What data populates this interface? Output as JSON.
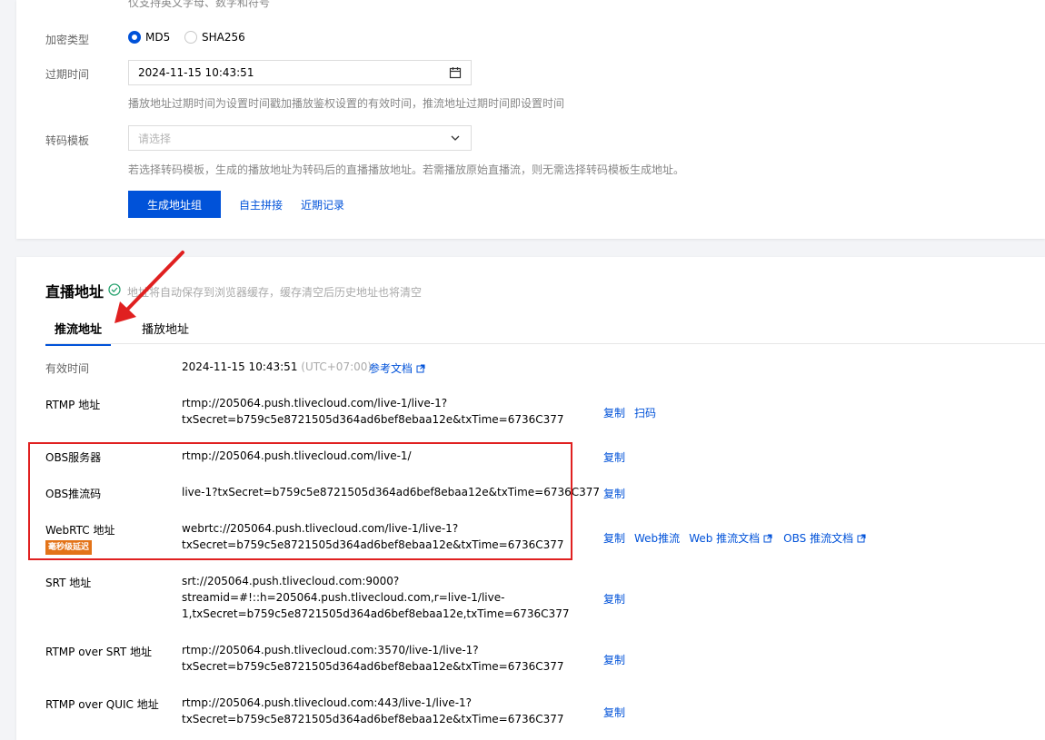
{
  "form": {
    "top_hint": "仅支持英文字母、数字和符号",
    "encrypt_label": "加密类型",
    "encrypt_options": [
      "MD5",
      "SHA256"
    ],
    "expire_label": "过期时间",
    "expire_value": "2024-11-15 10:43:51",
    "expire_hint": "播放地址过期时间为设置时间戳加播放鉴权设置的有效时间，推流地址过期时间即设置时间",
    "transcode_label": "转码模板",
    "transcode_placeholder": "请选择",
    "transcode_hint": "若选择转码模板，生成的播放地址为转码后的直播播放地址。若需播放原始直播流，则无需选择转码模板生成地址。",
    "generate_button": "生成地址组",
    "custom_link": "自主拼接",
    "recent_link": "近期记录"
  },
  "section": {
    "title": "直播地址",
    "note": "地址将自动保存到浏览器缓存，缓存清空后历史地址也将清空",
    "tabs": [
      "推流地址",
      "播放地址"
    ]
  },
  "validity": {
    "label": "有效时间",
    "value": "2024-11-15 10:43:51",
    "tz": "(UTC+07:00)",
    "doc_link": "参考文档"
  },
  "rows": {
    "rtmp": {
      "label": "RTMP 地址",
      "line1": "rtmp://205064.push.tlivecloud.com/live-1/live-1?",
      "line2": "txSecret=b759c5e8721505d364ad6bef8ebaa12e&txTime=6736C377",
      "copy": "复制",
      "scan": "扫码"
    },
    "obs_server": {
      "label": "OBS服务器",
      "line1": "rtmp://205064.push.tlivecloud.com/live-1/",
      "copy": "复制"
    },
    "obs_key": {
      "label": "OBS推流码",
      "line1": "live-1?txSecret=b759c5e8721505d364ad6bef8ebaa12e&txTime=6736C377",
      "copy": "复制"
    },
    "webrtc": {
      "label": "WebRTC 地址",
      "badge": "毫秒级延迟",
      "line1": "webrtc://205064.push.tlivecloud.com/live-1/live-1?",
      "line2": "txSecret=b759c5e8721505d364ad6bef8ebaa12e&txTime=6736C377",
      "copy": "复制",
      "web_push": "Web推流",
      "web_doc": "Web 推流文档",
      "obs_doc": "OBS 推流文档"
    },
    "srt": {
      "label": "SRT 地址",
      "line1": "srt://205064.push.tlivecloud.com:9000?",
      "line2": "streamid=#!::h=205064.push.tlivecloud.com,r=live-1/live-",
      "line3": "1,txSecret=b759c5e8721505d364ad6bef8ebaa12e,txTime=6736C377",
      "copy": "复制"
    },
    "rtmp_srt": {
      "label": "RTMP over SRT 地址",
      "line1": "rtmp://205064.push.tlivecloud.com:3570/live-1/live-1?",
      "line2": "txSecret=b759c5e8721505d364ad6bef8ebaa12e&txTime=6736C377",
      "copy": "复制"
    },
    "rtmp_quic": {
      "label": "RTMP over QUIC 地址",
      "line1": "rtmp://205064.push.tlivecloud.com:443/live-1/live-1?",
      "line2": "txSecret=b759c5e8721505d364ad6bef8ebaa12e&txTime=6736C377",
      "copy": "复制"
    }
  },
  "colors": {
    "primary": "#0052d9",
    "annotation": "#e02020",
    "badge": "#e37318",
    "success": "#2ba471"
  }
}
